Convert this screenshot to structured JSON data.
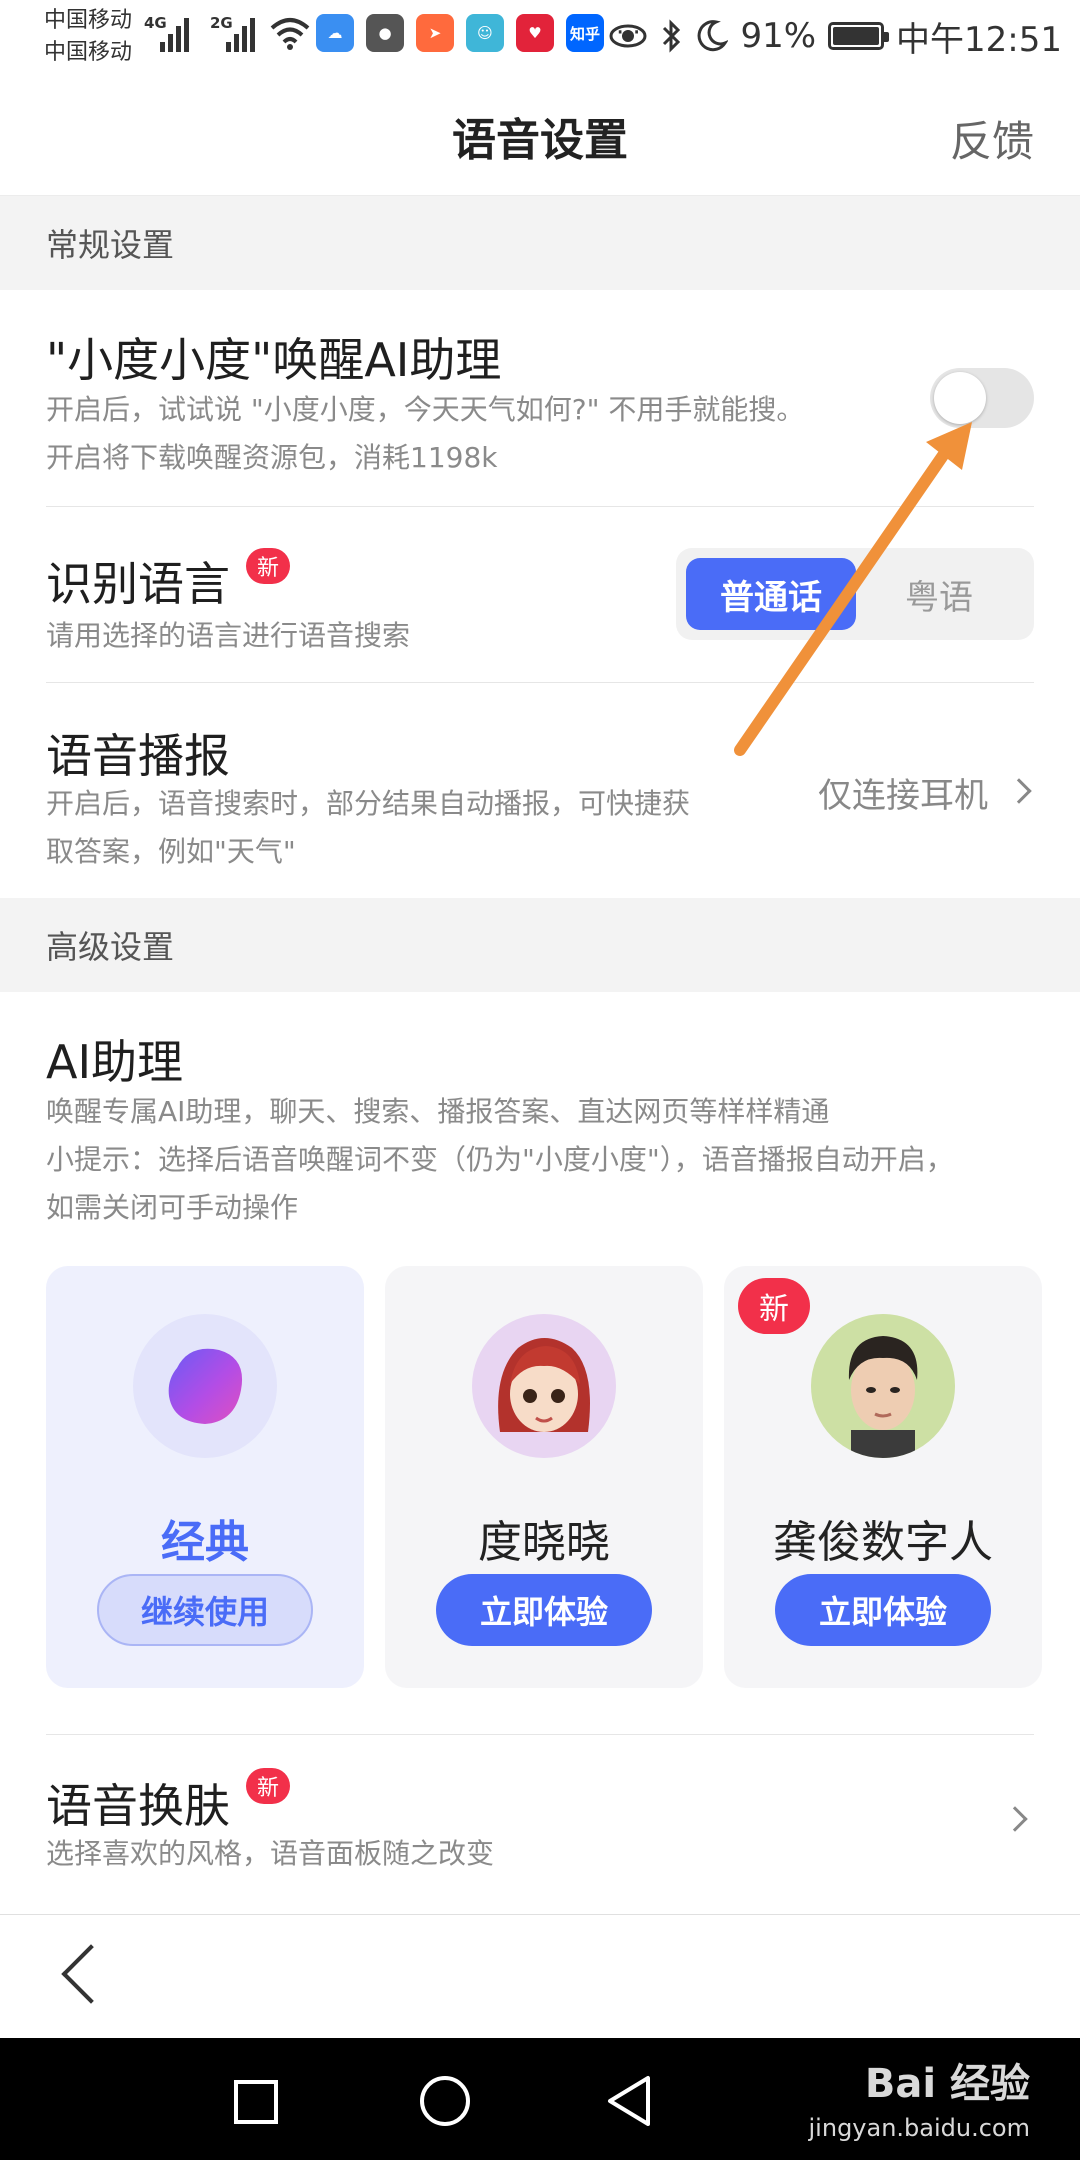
{
  "status_bar": {
    "carrier1": "中国移动",
    "carrier2": "中国移动",
    "net1": "4G",
    "net2": "2G",
    "app_icons": [
      {
        "name": "cloud-app-icon",
        "color": "#3a8ff2",
        "glyph": "☁"
      },
      {
        "name": "chat-app-icon",
        "color": "#555555",
        "glyph": "●"
      },
      {
        "name": "express-app-icon",
        "color": "#ff6a3d",
        "glyph": "➤"
      },
      {
        "name": "baby-app-icon",
        "color": "#3fb6d8",
        "glyph": "☺"
      },
      {
        "name": "heart-app-icon",
        "color": "#e2233a",
        "glyph": "♥"
      },
      {
        "name": "zhihu-app-icon",
        "color": "#0066ff",
        "glyph": "知乎"
      }
    ],
    "more": "···",
    "battery": "91%",
    "time": "中午12:51"
  },
  "nav": {
    "title": "语音设置",
    "feedback": "反馈"
  },
  "section_general": "常规设置",
  "wakeup": {
    "title": "\"小度小度\"唤醒AI助理",
    "desc1": "开启后，试试说 \"小度小度，今天天气如何?\" 不用手就能搜。",
    "desc2": "开启将下载唤醒资源包，消耗1198k",
    "enabled": false
  },
  "language": {
    "title": "识别语言",
    "badge": "新",
    "desc": "请用选择的语言进行语音搜索",
    "options": [
      "普通话",
      "粤语"
    ],
    "selected": "普通话"
  },
  "broadcast": {
    "title": "语音播报",
    "desc1": "开启后，语音搜索时，部分结果自动播报，可快捷获",
    "desc2": "取答案，例如\"天气\"",
    "value": "仅连接耳机"
  },
  "section_advanced": "高级设置",
  "assistant": {
    "title": "AI助理",
    "desc1": "唤醒专属AI助理，聊天、搜索、播报答案、直达网页等样样精通",
    "desc2": "小提示：选择后语音唤醒词不变（仍为\"小度小度\"），语音播报自动开启，",
    "desc3": "如需关闭可手动操作",
    "cards": [
      {
        "name": "经典",
        "button": "继续使用",
        "selected": true
      },
      {
        "name": "度晓晓",
        "button": "立即体验",
        "selected": false
      },
      {
        "name": "龚俊数字人",
        "button": "立即体验",
        "selected": false,
        "badge": "新"
      }
    ]
  },
  "skin": {
    "title": "语音换肤",
    "badge": "新",
    "desc": "选择喜欢的风格，语音面板随之改变"
  },
  "watermark": {
    "brand": "Bai 经验",
    "url": "jingyan.baidu.com"
  },
  "colors": {
    "accent": "#4a6cf7",
    "badge": "#f2304a",
    "arrow": "#f0913a"
  }
}
